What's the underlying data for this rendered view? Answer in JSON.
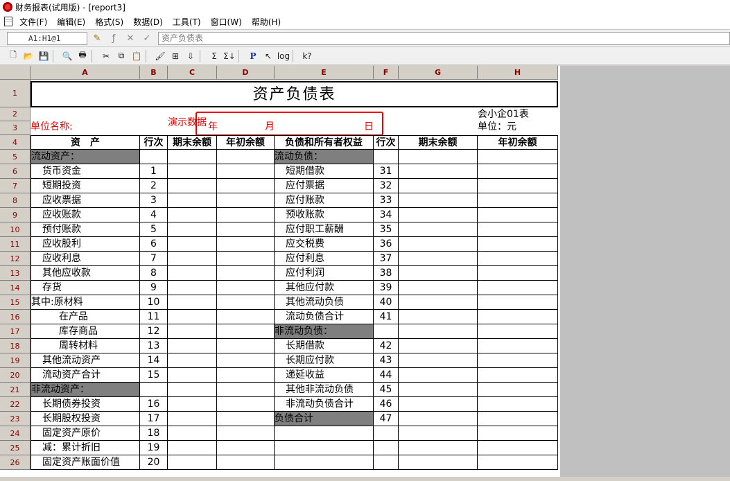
{
  "window": {
    "title": "财务报表(试用版) - [report3]"
  },
  "menu": [
    "文件(F)",
    "编辑(E)",
    "格式(S)",
    "数据(D)",
    "工具(T)",
    "窗口(W)",
    "帮助(H)"
  ],
  "formula": {
    "cell_ref": "A1:H1@1",
    "content": "资产负债表"
  },
  "toolbar": {
    "sum": "Σ",
    "sum2": "Σ↓",
    "p": "P",
    "log": "log",
    "help": "k?"
  },
  "columns": [
    "A",
    "B",
    "C",
    "D",
    "E",
    "F",
    "G",
    "H"
  ],
  "rows": [
    "1",
    "2",
    "3",
    "4",
    "5",
    "6",
    "7",
    "8",
    "9",
    "10",
    "11",
    "12",
    "13",
    "14",
    "15",
    "16",
    "17",
    "18",
    "19",
    "20",
    "21",
    "22",
    "23",
    "24",
    "25",
    "26"
  ],
  "report": {
    "title": "资产负债表",
    "form_code": "会小企01表",
    "unit_name_label": "单位名称:",
    "demo_label": "演示数据",
    "year": "年",
    "month": "月",
    "day": "日",
    "unit_label": "单位：元",
    "headers": {
      "asset": "资　产",
      "line_no": "行次",
      "end_balance": "期末余额",
      "begin_balance": "年初余额",
      "liab_equity": "负债和所有者权益",
      "line_no2": "行次",
      "end_balance2": "期末余额",
      "begin_balance2": "年初余额"
    },
    "left_rows": [
      {
        "label": "流动资产：",
        "no": "",
        "section": true,
        "indent": 0
      },
      {
        "label": "货币资金",
        "no": "1",
        "indent": 1
      },
      {
        "label": "短期投资",
        "no": "2",
        "indent": 1
      },
      {
        "label": "应收票据",
        "no": "3",
        "indent": 1
      },
      {
        "label": "应收账款",
        "no": "4",
        "indent": 1
      },
      {
        "label": "预付账款",
        "no": "5",
        "indent": 1
      },
      {
        "label": "应收股利",
        "no": "6",
        "indent": 1
      },
      {
        "label": "应收利息",
        "no": "7",
        "indent": 1
      },
      {
        "label": "其他应收款",
        "no": "8",
        "indent": 1
      },
      {
        "label": "存货",
        "no": "9",
        "indent": 1
      },
      {
        "label": "其中:原材料",
        "no": "10",
        "indent": 0
      },
      {
        "label": "在产品",
        "no": "11",
        "indent": 2
      },
      {
        "label": "库存商品",
        "no": "12",
        "indent": 2
      },
      {
        "label": "周转材料",
        "no": "13",
        "indent": 2
      },
      {
        "label": "其他流动资产",
        "no": "14",
        "indent": 1
      },
      {
        "label": "流动资产合计",
        "no": "15",
        "indent": 1
      },
      {
        "label": "非流动资产：",
        "no": "",
        "section": true,
        "indent": 0
      },
      {
        "label": "长期债券投资",
        "no": "16",
        "indent": 1
      },
      {
        "label": "长期股权投资",
        "no": "17",
        "indent": 1
      },
      {
        "label": "固定资产原价",
        "no": "18",
        "indent": 1
      },
      {
        "label": "减：累计折旧",
        "no": "19",
        "indent": 1
      },
      {
        "label": "固定资产账面价值",
        "no": "20",
        "indent": 1
      }
    ],
    "right_rows": [
      {
        "label": "流动负债：",
        "no": "",
        "section": true,
        "indent": 0
      },
      {
        "label": "短期借款",
        "no": "31",
        "indent": 1
      },
      {
        "label": "应付票据",
        "no": "32",
        "indent": 1
      },
      {
        "label": "应付账款",
        "no": "33",
        "indent": 1
      },
      {
        "label": "预收账款",
        "no": "34",
        "indent": 1
      },
      {
        "label": "应付职工薪酬",
        "no": "35",
        "indent": 1
      },
      {
        "label": "应交税费",
        "no": "36",
        "indent": 1
      },
      {
        "label": "应付利息",
        "no": "37",
        "indent": 1
      },
      {
        "label": "应付利润",
        "no": "38",
        "indent": 1
      },
      {
        "label": "其他应付款",
        "no": "39",
        "indent": 1
      },
      {
        "label": "其他流动负债",
        "no": "40",
        "indent": 1
      },
      {
        "label": "流动负债合计",
        "no": "41",
        "indent": 1
      },
      {
        "label": "非流动负债：",
        "no": "",
        "section": true,
        "indent": 0
      },
      {
        "label": "长期借款",
        "no": "42",
        "indent": 1
      },
      {
        "label": "长期应付款",
        "no": "43",
        "indent": 1
      },
      {
        "label": "递延收益",
        "no": "44",
        "indent": 1
      },
      {
        "label": "其他非流动负债",
        "no": "45",
        "indent": 1
      },
      {
        "label": "非流动负债合计",
        "no": "46",
        "indent": 1
      },
      {
        "label": "负债合计",
        "no": "47",
        "section": true,
        "indent": 0
      },
      {
        "label": "",
        "no": "",
        "indent": 0
      },
      {
        "label": "",
        "no": "",
        "indent": 0
      },
      {
        "label": "",
        "no": "",
        "indent": 0
      }
    ]
  },
  "colors": {
    "section_fill": "#7f7f7f",
    "header_text": "#8b0000",
    "highlight": "#ee0000"
  }
}
